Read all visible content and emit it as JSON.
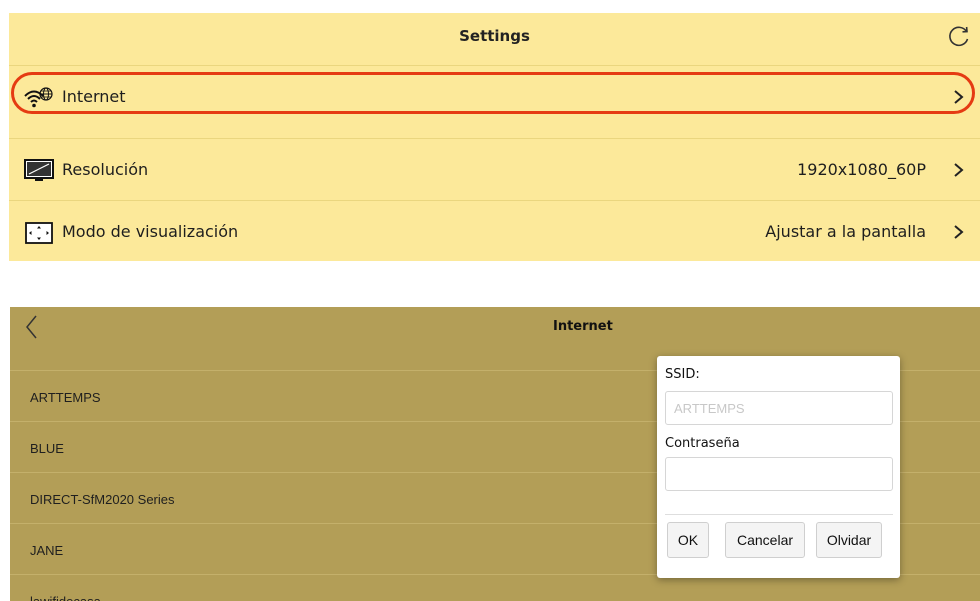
{
  "settings": {
    "title": "Settings",
    "rows": [
      {
        "label": "Internet",
        "value": "",
        "icon": "wifi-globe-icon"
      },
      {
        "label": "Resolución",
        "value": "1920x1080_60P",
        "icon": "monitor-icon"
      },
      {
        "label": "Modo de visualización",
        "value": "Ajustar a la pantalla",
        "icon": "display-mode-icon"
      }
    ]
  },
  "internet": {
    "title": "Internet",
    "networks": [
      "ARTTEMPS",
      "BLUE",
      "DIRECT-SfM2020 Series",
      "JANE",
      "lawifidecasa"
    ]
  },
  "dialog": {
    "ssid_label": "SSID:",
    "ssid_placeholder": "ARTTEMPS",
    "password_label": "Contraseña",
    "password_value": "",
    "ok_label": "OK",
    "cancel_label": "Cancelar",
    "forget_label": "Olvidar"
  },
  "colors": {
    "settings_bg": "#fce99a",
    "internet_bg": "#b39e57",
    "highlight": "#e53b12"
  }
}
